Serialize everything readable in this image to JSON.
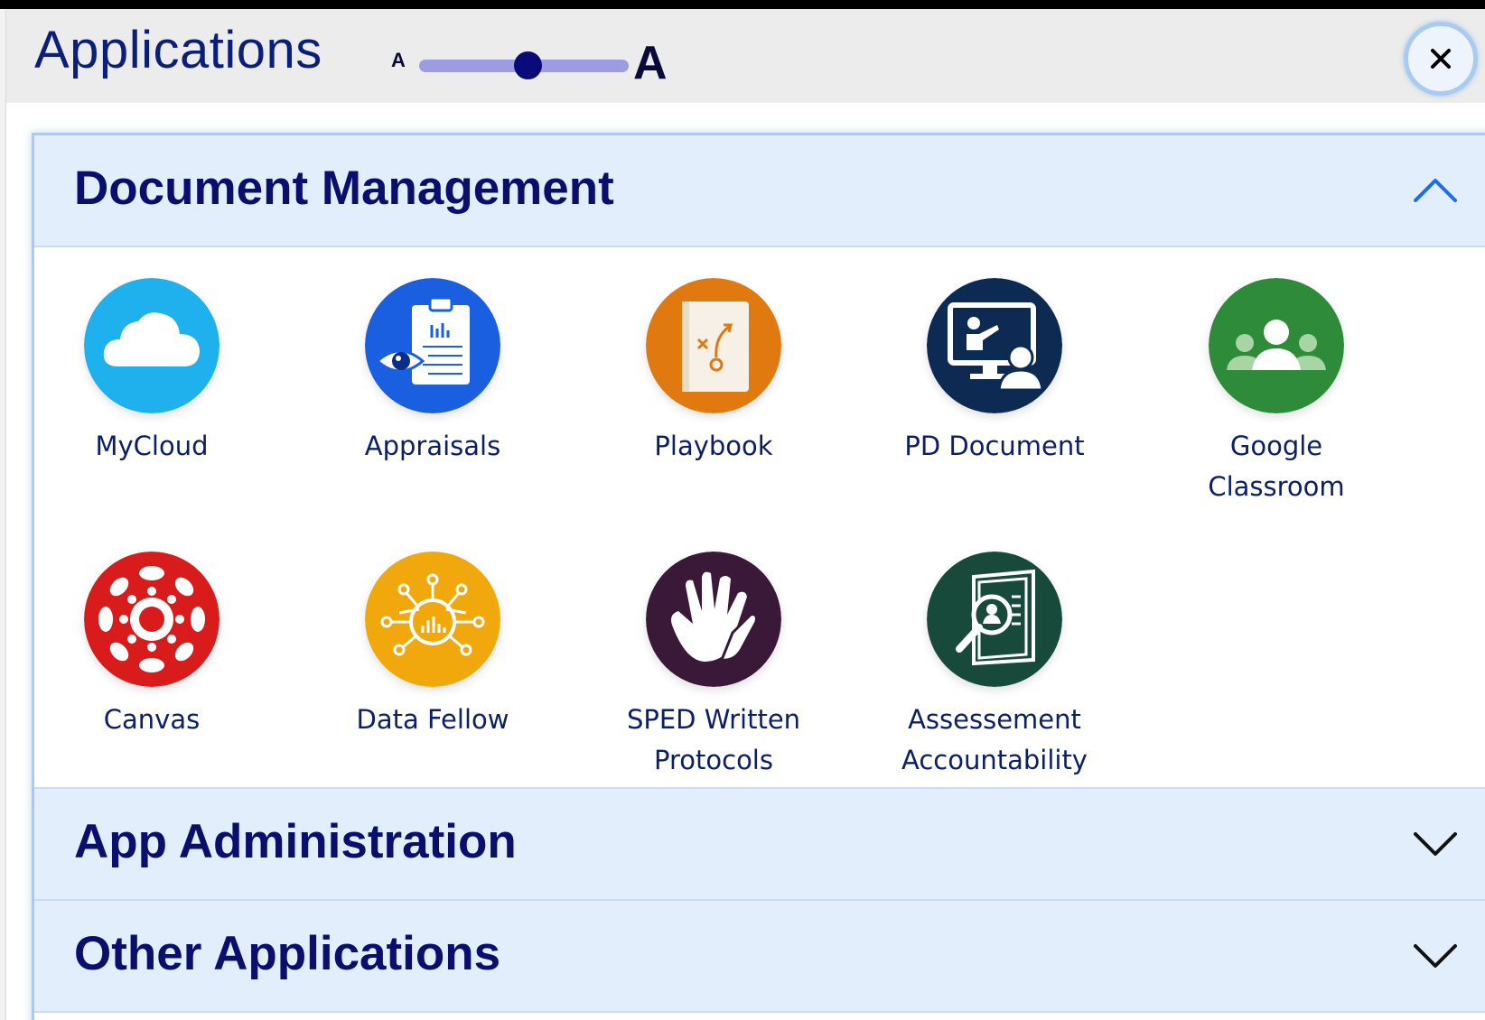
{
  "header": {
    "title": "Applications",
    "font_size_small": "A",
    "font_size_large": "A",
    "font_size_level": 0.5,
    "close_label": "×"
  },
  "sections": [
    {
      "title": "Document Management",
      "expanded": true,
      "apps": [
        {
          "label": "MyCloud",
          "icon": "cloud-icon",
          "color": "#1fb0ee"
        },
        {
          "label": "Appraisals",
          "icon": "clipboard-eye-icon",
          "color": "#1a5fe0"
        },
        {
          "label": "Playbook",
          "icon": "playbook-icon",
          "color": "#e07a10"
        },
        {
          "label": "PD Document",
          "icon": "presentation-icon",
          "color": "#0d2a52"
        },
        {
          "label": "Google Classroom",
          "icon": "classroom-icon",
          "color": "#2e8b3a"
        },
        {
          "label": "Canvas",
          "icon": "canvas-icon",
          "color": "#d81c1c"
        },
        {
          "label": "Data Fellow",
          "icon": "data-network-icon",
          "color": "#f0a80c"
        },
        {
          "label": "SPED Written Protocols",
          "icon": "hands-icon",
          "color": "#3a1838"
        },
        {
          "label": "Assessement Accountability",
          "icon": "document-search-icon",
          "color": "#174a3b"
        }
      ]
    },
    {
      "title": "App Administration",
      "expanded": false
    },
    {
      "title": "Other Applications",
      "expanded": false
    }
  ]
}
